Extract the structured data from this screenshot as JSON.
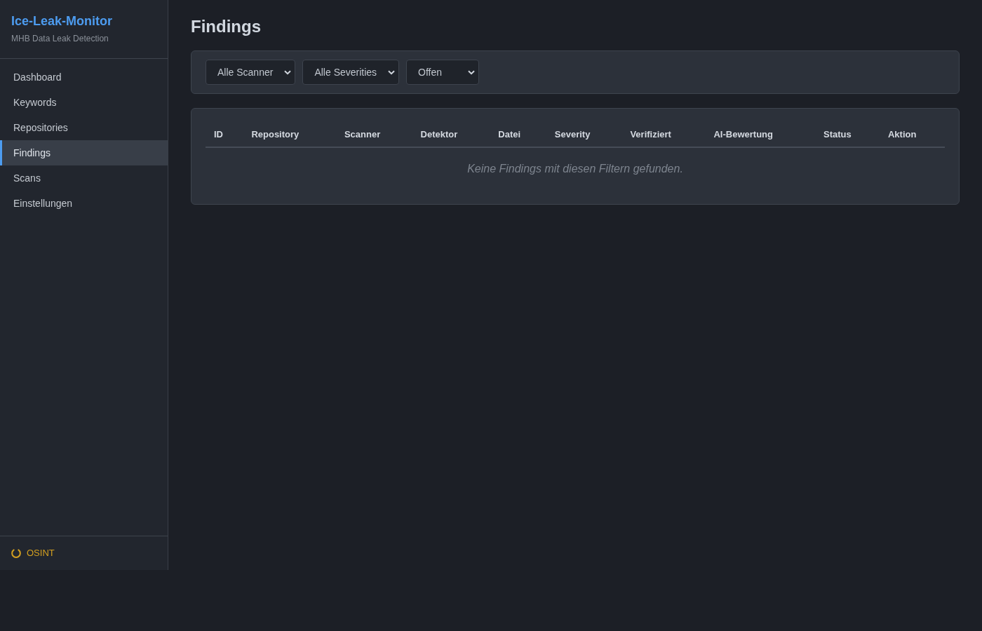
{
  "sidebar": {
    "app_title": "Ice-Leak-Monitor",
    "subtitle": "MHB Data Leak Detection",
    "items": [
      {
        "label": "Dashboard",
        "selected": false
      },
      {
        "label": "Keywords",
        "selected": false
      },
      {
        "label": "Repositories",
        "selected": false
      },
      {
        "label": "Findings",
        "selected": true
      },
      {
        "label": "Scans",
        "selected": false
      },
      {
        "label": "Einstellungen",
        "selected": false
      }
    ],
    "status": {
      "label": "OSINT"
    }
  },
  "page_title": "Findings",
  "filters": [
    {
      "value": "Alle Scanner"
    },
    {
      "value": "Alle Severities"
    },
    {
      "value": "Offen"
    }
  ],
  "table": {
    "columns": [
      "ID",
      "Repository",
      "Scanner",
      "Detektor",
      "Datei",
      "Severity",
      "Verifiziert",
      "AI-Bewertung",
      "Status",
      "Aktion"
    ],
    "empty_message": "Keine Findings mit diesen Filtern gefunden."
  }
}
